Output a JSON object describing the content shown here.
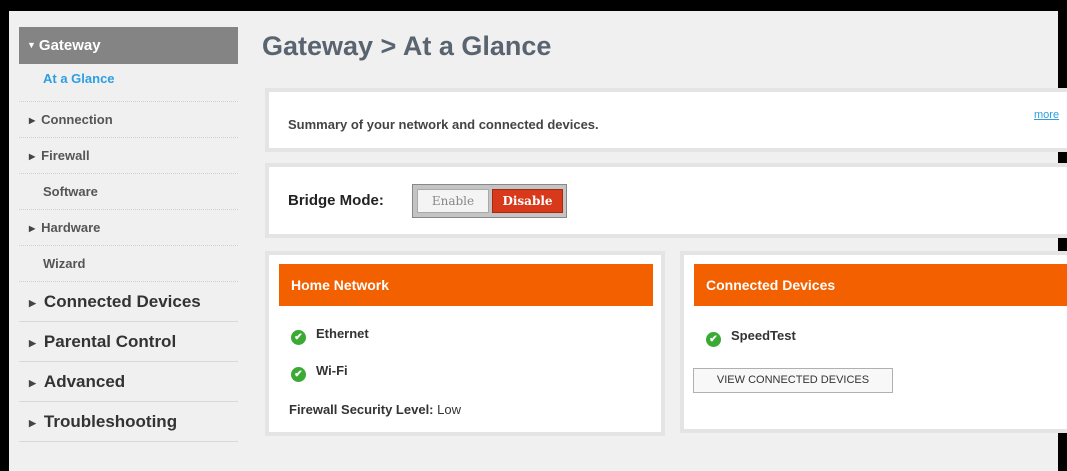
{
  "page": {
    "title": "Gateway > At a Glance"
  },
  "sidebar": {
    "active_section": "Gateway",
    "sub_items": [
      {
        "label": "At a Glance",
        "expandable": false,
        "selected": true
      },
      {
        "label": "Connection",
        "expandable": true,
        "selected": false
      },
      {
        "label": "Firewall",
        "expandable": true,
        "selected": false
      },
      {
        "label": "Software",
        "expandable": false,
        "selected": false
      },
      {
        "label": "Hardware",
        "expandable": true,
        "selected": false
      },
      {
        "label": "Wizard",
        "expandable": false,
        "selected": false
      }
    ],
    "main_items": [
      {
        "label": "Connected Devices"
      },
      {
        "label": "Parental Control"
      },
      {
        "label": "Advanced"
      },
      {
        "label": "Troubleshooting"
      }
    ]
  },
  "summary": {
    "text": "Summary of your network and connected devices.",
    "more_link": "more"
  },
  "bridge_mode": {
    "label": "Bridge Mode:",
    "enable_label": "Enable",
    "disable_label": "Disable",
    "selected": "Disable"
  },
  "home_network": {
    "title": "Home Network",
    "items": [
      {
        "label": "Ethernet",
        "status": "ok"
      },
      {
        "label": "Wi-Fi",
        "status": "ok"
      }
    ],
    "firewall_label": "Firewall Security Level:",
    "firewall_value": "Low"
  },
  "connected_devices": {
    "title": "Connected Devices",
    "devices": [
      {
        "label": "SpeedTest",
        "status": "ok"
      }
    ],
    "view_button": "VIEW CONNECTED DEVICES"
  },
  "colors": {
    "accent_orange": "#f26000",
    "disable_red": "#d8391a",
    "link_blue": "#2b9fe0",
    "ok_green": "#3aaa35",
    "nav_active_bg": "#848484"
  }
}
